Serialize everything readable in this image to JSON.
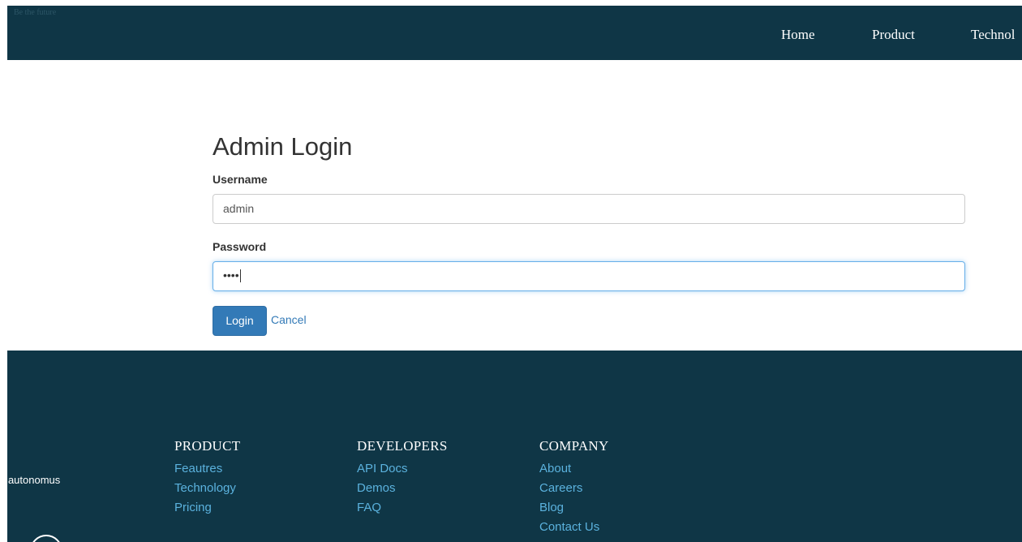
{
  "header": {
    "brand": "Be the future",
    "nav": [
      {
        "label": "Home"
      },
      {
        "label": "Product"
      },
      {
        "label": "Technol"
      }
    ]
  },
  "login": {
    "title": "Admin Login",
    "username_label": "Username",
    "username_value": "admin",
    "password_label": "Password",
    "password_value": "••••",
    "login_button": "Login",
    "cancel_link": "Cancel"
  },
  "footer": {
    "tagline": "r autonomus",
    "columns": [
      {
        "heading": "PRODUCT",
        "links": [
          "Feautres",
          "Technology",
          "Pricing"
        ]
      },
      {
        "heading": "DEVELOPERS",
        "links": [
          "API Docs",
          "Demos",
          "FAQ"
        ]
      },
      {
        "heading": "COMPANY",
        "links": [
          "About",
          "Careers",
          "Blog",
          "Contact Us"
        ]
      }
    ]
  },
  "colors": {
    "navbar_bg": "#0f3646",
    "primary": "#337ab7",
    "footer_link": "#5bb2de",
    "focus_border": "#66afe9"
  }
}
